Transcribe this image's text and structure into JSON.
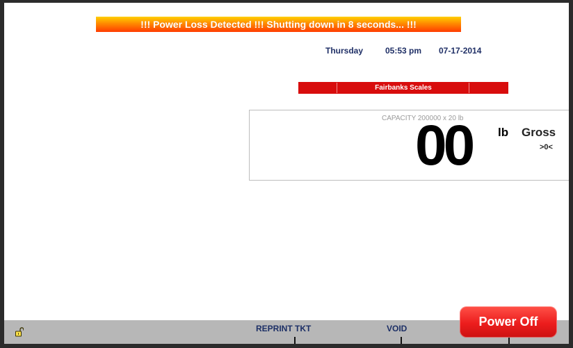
{
  "alert": {
    "message": "!!! Power Loss Detected !!! Shutting down in 8 seconds... !!!"
  },
  "datetime": {
    "day": "Thursday",
    "time": "05:53 pm",
    "date": "07-17-2014"
  },
  "scale": {
    "name": "Fairbanks Scales",
    "capacity": "CAPACITY 200000 x 20 lb",
    "weight": "00",
    "unit": "lb",
    "mode": "Gross",
    "zero_indicator": ">0<"
  },
  "softkeys": {
    "reprint": "REPRINT TKT",
    "void": "VOID",
    "power_off": "Power Off"
  },
  "icons": {
    "lock": "unlocked-padlock-icon"
  },
  "colors": {
    "banner_top": "#ffcf00",
    "banner_bottom": "#ff3c00",
    "scale_bar": "#d80d0d",
    "datetime_text": "#1f2f66",
    "softkey_bar": "#b7b7b7",
    "power_off": "#ec1d1d"
  }
}
